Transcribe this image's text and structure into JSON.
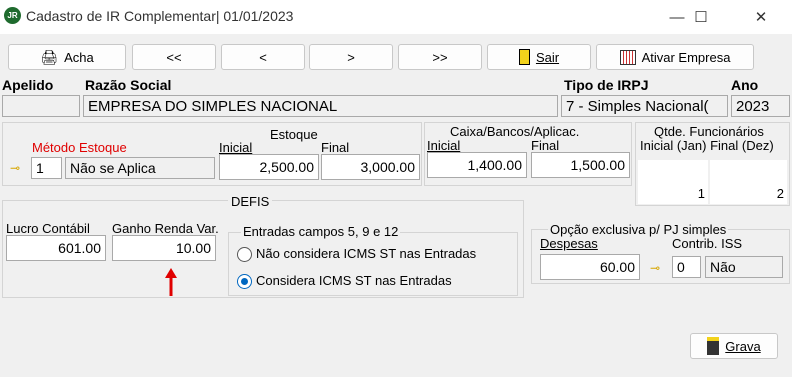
{
  "window": {
    "title": "Cadastro de IR Complementar|  01/01/2023",
    "app_icon": "JR",
    "minimize": "—",
    "maximize": "☐",
    "close": "✕"
  },
  "toolbar": {
    "acha": "Acha",
    "first": "<<",
    "prev": "<",
    "next": ">",
    "last": ">>",
    "sair": "Sair",
    "ativar": "Ativar Empresa"
  },
  "header": {
    "apelido_label": "Apelido",
    "razao_label": "Razão Social",
    "tipo_label": "Tipo de IRPJ",
    "ano_label": "Ano",
    "apelido_value": "",
    "razao_value": "EMPRESA DO SIMPLES NACIONAL",
    "tipo_value": "7 - Simples Nacional(",
    "ano_value": "2023"
  },
  "estoque": {
    "metodo_label": "Método Estoque",
    "metodo_code": "1",
    "metodo_value": "Não se Aplica",
    "title": "Estoque",
    "inicial_label": "Inicial",
    "final_label": "Final",
    "inicial_value": "2,500.00",
    "final_value": "3,000.00"
  },
  "caixa": {
    "title": "Caixa/Bancos/Aplicac.",
    "inicial_label": "Inicial",
    "final_label": "Final",
    "inicial_value": "1,400.00",
    "final_value": "1,500.00"
  },
  "funcionarios": {
    "title": "Qtde. Funcionários",
    "subtitle": "Inicial (Jan) Final (Dez)",
    "inicial_value": "1",
    "final_value": "2"
  },
  "defis": {
    "title": "DEFIS",
    "lucro_label": "Lucro Contábil",
    "lucro_value": "601.00",
    "ganho_label": "Ganho Renda Var.",
    "ganho_value": "10.00",
    "entradas_title": "Entradas campos 5, 9 e 12",
    "radio1": "Não considera ICMS ST nas Entradas",
    "radio2": "Considera ICMS ST nas Entradas",
    "selected": 2
  },
  "pj_simples": {
    "title": "Opção exclusiva p/ PJ simples",
    "despesas_label": "Despesas",
    "despesas_value": "60.00",
    "contrib_label": "Contrib. ISS",
    "contrib_code": "0",
    "contrib_value": "Não"
  },
  "grava": "Grava",
  "colors": {
    "accent": "#0067c0",
    "estoque_label": "#e00000",
    "arrow": "#e00000"
  }
}
